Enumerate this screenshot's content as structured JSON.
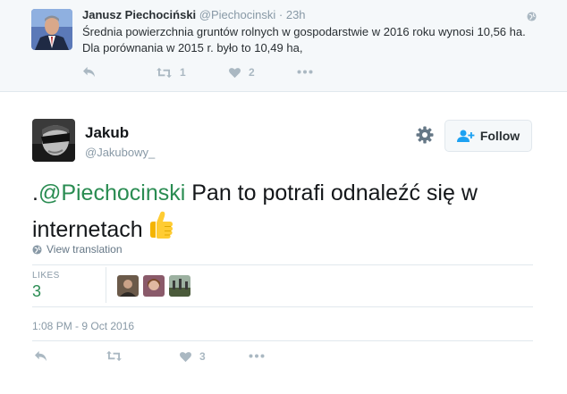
{
  "parent_tweet": {
    "name": "Janusz Piechociński",
    "handle": "@Piechocinski",
    "dot": "·",
    "time": "23h",
    "text": "Średnia powierzchnia gruntów rolnych w gospodarstwie w 2016 roku wynosi 10,56 ha. Dla porównania w 2015 r. było to 10,49 ha,",
    "retweet_count": "1",
    "like_count": "2"
  },
  "tweet": {
    "name": "Jakub",
    "handle": "@Jakubowy_",
    "follow_label": "Follow",
    "text_prefix": ".",
    "mention": "@Piechocinski",
    "text_body": " Pan to potrafi odnaleźć się w internetach",
    "view_translation": "View translation",
    "likes_label": "LIKES",
    "likes_count": "3",
    "timestamp": "1:08 PM - 9 Oct 2016",
    "action_like_count": "3"
  },
  "colors": {
    "accent": "#2a8c52",
    "muted": "#aab8c2",
    "border": "#e1e8ed"
  }
}
